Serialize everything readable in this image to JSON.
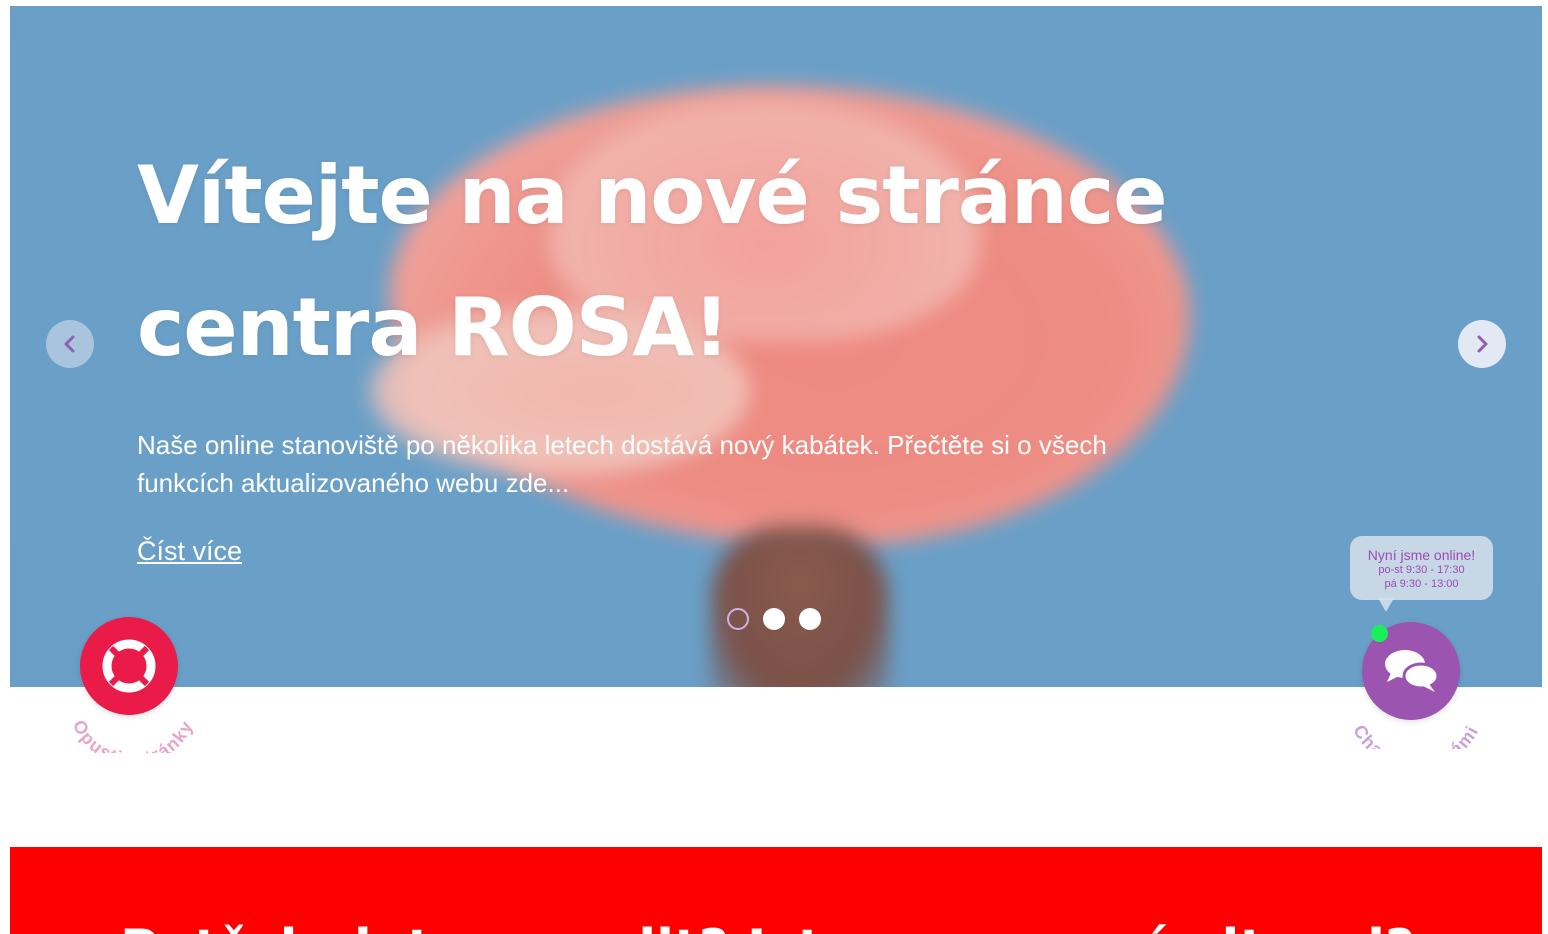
{
  "hero": {
    "title_line1": "Vítejte na nové stránce",
    "title_line2": "centra ROSA!",
    "description": "Naše online stanoviště po několika letech dostává nový kabátek. Přečtěte si o všech funkcích aktualizovaného webu zde...",
    "read_more": "Číst více",
    "slides_total": 3,
    "active_slide": 1
  },
  "carousel": {
    "prev_icon": "chevron-left-icon",
    "next_icon": "chevron-right-icon"
  },
  "exit_widget": {
    "label": "Opustit stránky",
    "icon": "lifebuoy-icon"
  },
  "chat_widget": {
    "status": "Nyní jsme online!",
    "hours_weekdays": "po-st 9:30 - 17:30",
    "hours_friday": "pá 9:30 - 13:00",
    "label": "Chatujte s námi",
    "icon": "chat-bubbles-icon"
  },
  "section": {
    "heading": "Potřebujete poradit? Jste v nouzové situaci?"
  },
  "colors": {
    "exit_red": "#ea1b49",
    "chat_purple": "#9b55b0",
    "band_red": "#ff0000",
    "online_green": "#18f05a"
  }
}
